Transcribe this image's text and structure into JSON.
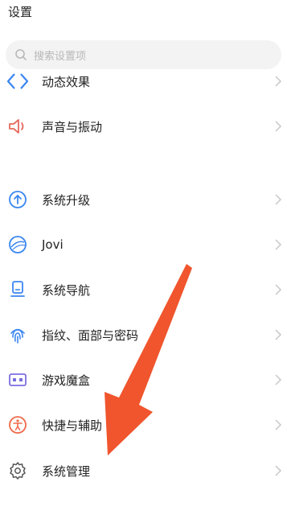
{
  "header": {
    "title": "设置"
  },
  "search": {
    "placeholder": "搜索设置项"
  },
  "menu": {
    "items": [
      {
        "label": "动态效果",
        "icon": "animation-effect-icon"
      },
      {
        "label": "声音与振动",
        "icon": "speaker-icon"
      },
      {
        "label": "系统升级",
        "icon": "system-update-icon"
      },
      {
        "label": "Jovi",
        "icon": "jovi-icon"
      },
      {
        "label": "系统导航",
        "icon": "system-navigation-icon"
      },
      {
        "label": "指纹、面部与密码",
        "icon": "fingerprint-icon"
      },
      {
        "label": "游戏魔盒",
        "icon": "game-box-icon"
      },
      {
        "label": "快捷与辅助",
        "icon": "accessibility-icon"
      },
      {
        "label": "系统管理",
        "icon": "gear-icon"
      }
    ]
  },
  "colors": {
    "accent_blue": "#3b86f0",
    "sound_red": "#e56a5c",
    "game_purple": "#7a6fe0",
    "access_orange": "#ee6a4a",
    "arrow_orange": "#f0552d"
  }
}
